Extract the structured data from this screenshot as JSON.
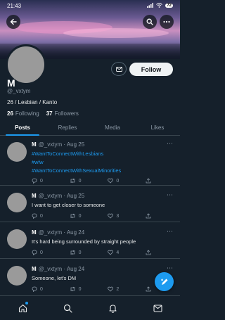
{
  "status_bar": {
    "time": "21:43",
    "battery": "72"
  },
  "profile": {
    "name": "M",
    "handle": "@_vxtym",
    "bio": "26 / Lesbian / Kanto",
    "following_count": "26",
    "following_label": "Following",
    "followers_count": "37",
    "followers_label": "Followers",
    "follow_label": "Follow"
  },
  "tabs": [
    {
      "label": "Posts",
      "active": true
    },
    {
      "label": "Replies",
      "active": false
    },
    {
      "label": "Media",
      "active": false
    },
    {
      "label": "Likes",
      "active": false
    }
  ],
  "tweets": [
    {
      "name": "M",
      "handle": "@_vxtym",
      "date": "· Aug 25",
      "hashtags": [
        "#WantToConnectWithLesbians",
        "#wlw",
        "#WantToConnectWithSexualMinorities"
      ],
      "text": "",
      "replies": "0",
      "retweets": "0",
      "likes": "0"
    },
    {
      "name": "M",
      "handle": "@_vxtym",
      "date": "· Aug 25",
      "hashtags": [],
      "text": "I want to get closer to someone",
      "replies": "0",
      "retweets": "0",
      "likes": "3"
    },
    {
      "name": "M",
      "handle": "@_vxtym",
      "date": "· Aug 24",
      "hashtags": [],
      "text": "It's hard being surrounded by straight people",
      "replies": "0",
      "retweets": "0",
      "likes": "4"
    },
    {
      "name": "M",
      "handle": "@_vxtym",
      "date": "· Aug 24",
      "hashtags": [],
      "text": "Someone, let's DM",
      "replies": "0",
      "retweets": "0",
      "likes": "2"
    }
  ],
  "colors": {
    "accent": "#1d9bf0",
    "background": "#15202b",
    "muted": "#8b98a5"
  },
  "icons": {
    "back": "arrow-left-icon",
    "search": "search-icon",
    "more": "more-icon",
    "message": "mail-icon",
    "compose": "compose-icon",
    "nav": [
      "home-icon",
      "search-icon",
      "bell-icon",
      "mail-icon"
    ]
  }
}
